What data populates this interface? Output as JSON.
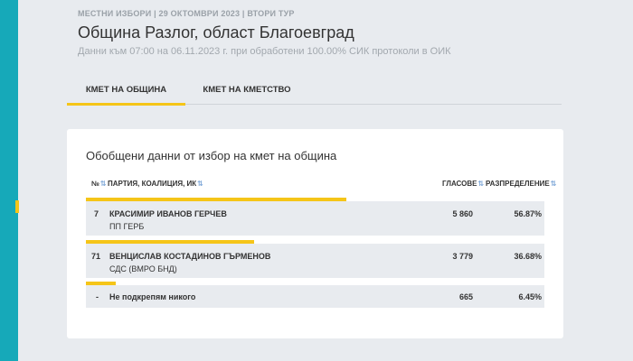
{
  "header": {
    "kicker": "МЕСТНИ ИЗБОРИ | 29 ОКТОМВРИ 2023 | ВТОРИ ТУР",
    "title": "Община Разлог, област Благоевград",
    "subtitle": "Данни към 07:00 на 06.11.2023 г. при обработени 100.00% СИК протоколи в ОИК"
  },
  "tabs": [
    {
      "label": "КМЕТ НА ОБЩИНА",
      "active": true
    },
    {
      "label": "КМЕТ НА КМЕТСТВО",
      "active": false
    }
  ],
  "card": {
    "title": "Обобщени данни от избор на кмет на община",
    "columns": {
      "num": "№",
      "party": "ПАРТИЯ, КОАЛИЦИЯ, ИК",
      "votes": "ГЛАСОВЕ",
      "share": "РАЗПРЕДЕЛЕНИЕ"
    },
    "sort_icon": "⇅",
    "rows": [
      {
        "num": "7",
        "name": "КРАСИМИР ИВАНОВ ГЕРЧЕВ",
        "party": "ПП ГЕРБ",
        "votes": "5 860",
        "share": "56.87%",
        "share_value": 56.87
      },
      {
        "num": "71",
        "name": "ВЕНЦИСЛАВ КОСТАДИНОВ ГЪРМЕНОВ",
        "party": "СДС (ВМРО БНД)",
        "votes": "3 779",
        "share": "36.68%",
        "share_value": 36.68
      },
      {
        "num": "-",
        "name": "Не подкрепям никого",
        "party": "",
        "votes": "665",
        "share": "6.45%",
        "share_value": 6.45
      }
    ]
  },
  "colors": {
    "accent": "#f5c518",
    "sidebar": "#16a9b9",
    "background": "#e8ebef",
    "row": "#e8ebef"
  }
}
